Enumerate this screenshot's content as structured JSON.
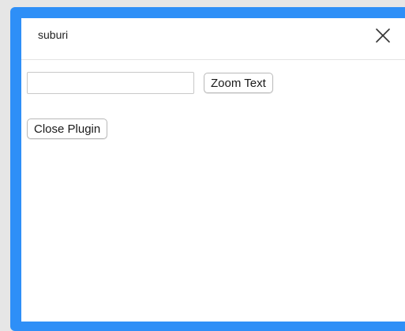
{
  "dialog": {
    "title": "suburi"
  },
  "form": {
    "text_input_value": "",
    "text_input_placeholder": "",
    "zoom_label": "Zoom Text",
    "close_plugin_label": "Close Plugin"
  },
  "colors": {
    "frame_accent": "#2e8ff7",
    "panel_background": "#ffffff"
  },
  "icons": {
    "close": "close-icon"
  }
}
